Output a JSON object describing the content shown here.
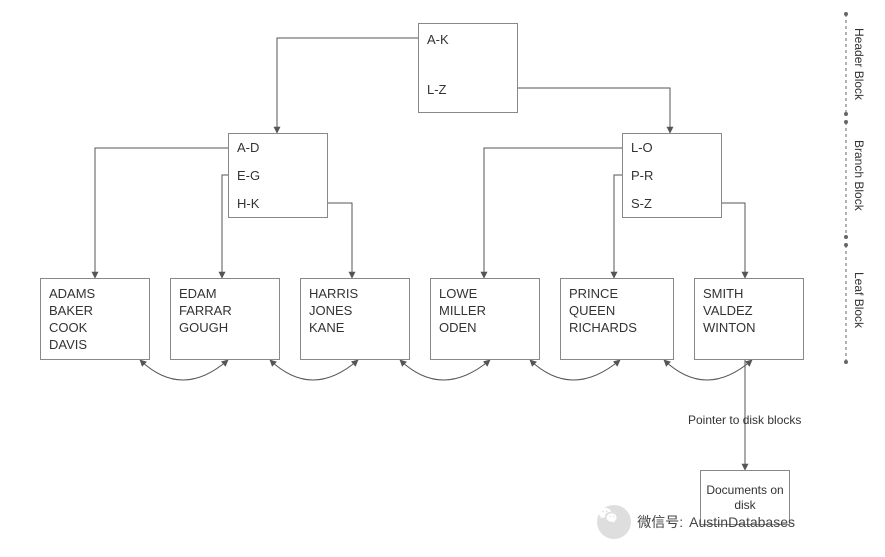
{
  "chart_data": {
    "type": "diagram",
    "title": "",
    "structure": "B-tree index",
    "levels": [
      {
        "name": "Header Block",
        "nodes": [
          {
            "keys": [
              "A-K",
              "L-Z"
            ]
          }
        ]
      },
      {
        "name": "Branch Block",
        "nodes": [
          {
            "keys": [
              "A-D",
              "E-G",
              "H-K"
            ]
          },
          {
            "keys": [
              "L-O",
              "P-R",
              "S-Z"
            ]
          }
        ]
      },
      {
        "name": "Leaf Block",
        "nodes": [
          {
            "entries": [
              "ADAMS",
              "BAKER",
              "COOK",
              "DAVIS"
            ]
          },
          {
            "entries": [
              "EDAM",
              "FARRAR",
              "GOUGH"
            ]
          },
          {
            "entries": [
              "HARRIS",
              "JONES",
              "KANE"
            ]
          },
          {
            "entries": [
              "LOWE",
              "MILLER",
              "ODEN"
            ]
          },
          {
            "entries": [
              "PRINCE",
              "QUEEN",
              "RICHARDS"
            ]
          },
          {
            "entries": [
              "SMITH",
              "VALDEZ",
              "WINTON"
            ]
          }
        ]
      }
    ],
    "leaf_sibling_links": "bidirectional",
    "pointer_label": "Pointer to disk blocks",
    "target": "Documents on disk"
  },
  "header": {
    "k0": "A-K",
    "k1": "L-Z"
  },
  "branchL": {
    "k0": "A-D",
    "k1": "E-G",
    "k2": "H-K"
  },
  "branchR": {
    "k0": "L-O",
    "k1": "P-R",
    "k2": "S-Z"
  },
  "leaves": {
    "l0": {
      "r0": "ADAMS",
      "r1": "BAKER",
      "r2": "COOK",
      "r3": "DAVIS"
    },
    "l1": {
      "r0": "EDAM",
      "r1": "FARRAR",
      "r2": "GOUGH"
    },
    "l2": {
      "r0": "HARRIS",
      "r1": "JONES",
      "r2": "KANE"
    },
    "l3": {
      "r0": "LOWE",
      "r1": "MILLER",
      "r2": "ODEN"
    },
    "l4": {
      "r0": "PRINCE",
      "r1": "QUEEN",
      "r2": "RICHARDS"
    },
    "l5": {
      "r0": "SMITH",
      "r1": "VALDEZ",
      "r2": "WINTON"
    }
  },
  "side": {
    "header": "Header Block",
    "branch": "Branch Block",
    "leaf": "Leaf Block"
  },
  "pointer_label": "Pointer to disk blocks",
  "disk_label": "Documents on disk",
  "watermark": {
    "prefix": "微信号:",
    "handle": "AustinDatabases"
  }
}
